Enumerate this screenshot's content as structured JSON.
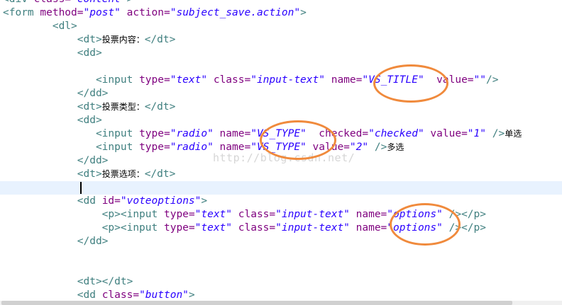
{
  "colors": {
    "tag": "#3f7f7f",
    "attribute": "#7f007f",
    "value": "#2a00ff",
    "highlight": "#f08a3c",
    "current_line": "#e8f2fe"
  },
  "lines": [
    [
      {
        "t": "<div ",
        "c": "tag"
      },
      {
        "t": "class=",
        "c": "attr"
      },
      {
        "t": "\"content\"",
        "c": "val"
      },
      {
        "t": ">",
        "c": "tag"
      }
    ],
    [
      {
        "t": "<form ",
        "c": "tag"
      },
      {
        "t": "method=",
        "c": "attr"
      },
      {
        "t": "\"post\"",
        "c": "val"
      },
      {
        "t": " action=",
        "c": "attr"
      },
      {
        "t": "\"subject_save.action\"",
        "c": "val"
      },
      {
        "t": ">",
        "c": "tag"
      }
    ],
    [
      {
        "t": "        <dl>",
        "c": "tag"
      }
    ],
    [
      {
        "t": "            <dt>",
        "c": "tag"
      },
      {
        "t": "投票内容：",
        "c": "txt"
      },
      {
        "t": "</dt>",
        "c": "tag"
      }
    ],
    [
      {
        "t": "            <dd>",
        "c": "tag"
      }
    ],
    [
      {
        "t": "",
        "c": "tag"
      }
    ],
    [
      {
        "t": "               <input ",
        "c": "tag"
      },
      {
        "t": "type=",
        "c": "attr"
      },
      {
        "t": "\"text\"",
        "c": "val"
      },
      {
        "t": " class=",
        "c": "attr"
      },
      {
        "t": "\"input-text\"",
        "c": "val"
      },
      {
        "t": " name=",
        "c": "attr"
      },
      {
        "t": "\"VS_TITLE\"",
        "c": "val"
      },
      {
        "t": "  value=",
        "c": "attr"
      },
      {
        "t": "\"\"",
        "c": "val"
      },
      {
        "t": "/>",
        "c": "tag"
      }
    ],
    [
      {
        "t": "            </dd>",
        "c": "tag"
      }
    ],
    [
      {
        "t": "            <dt>",
        "c": "tag"
      },
      {
        "t": "投票类型：",
        "c": "txt"
      },
      {
        "t": "</dt>",
        "c": "tag"
      }
    ],
    [
      {
        "t": "            <dd>",
        "c": "tag"
      }
    ],
    [
      {
        "t": "               <input ",
        "c": "tag"
      },
      {
        "t": "type=",
        "c": "attr"
      },
      {
        "t": "\"radio\"",
        "c": "val"
      },
      {
        "t": " name=",
        "c": "attr"
      },
      {
        "t": "\"VS_TYPE\"",
        "c": "val"
      },
      {
        "t": "  checked=",
        "c": "attr"
      },
      {
        "t": "\"checked\"",
        "c": "val"
      },
      {
        "t": " value=",
        "c": "attr"
      },
      {
        "t": "\"1\"",
        "c": "val"
      },
      {
        "t": " />",
        "c": "tag"
      },
      {
        "t": "单选",
        "c": "txt"
      }
    ],
    [
      {
        "t": "               <input ",
        "c": "tag"
      },
      {
        "t": "type=",
        "c": "attr"
      },
      {
        "t": "\"radio\"",
        "c": "val"
      },
      {
        "t": " name=",
        "c": "attr"
      },
      {
        "t": "\"VS_TYPE\"",
        "c": "val"
      },
      {
        "t": " value=",
        "c": "attr"
      },
      {
        "t": "\"2\"",
        "c": "val"
      },
      {
        "t": " />",
        "c": "tag"
      },
      {
        "t": "多选",
        "c": "txt"
      }
    ],
    [
      {
        "t": "            </dd>",
        "c": "tag"
      }
    ],
    [
      {
        "t": "            <dt>",
        "c": "tag"
      },
      {
        "t": "投票选项：",
        "c": "txt"
      },
      {
        "t": "</dt>",
        "c": "tag"
      }
    ],
    [
      {
        "t": "",
        "c": "tag"
      }
    ],
    [
      {
        "t": "            <dd ",
        "c": "tag"
      },
      {
        "t": "id=",
        "c": "attr"
      },
      {
        "t": "\"voteoptions\"",
        "c": "val"
      },
      {
        "t": ">",
        "c": "tag"
      }
    ],
    [
      {
        "t": "                <p><input ",
        "c": "tag"
      },
      {
        "t": "type=",
        "c": "attr"
      },
      {
        "t": "\"text\"",
        "c": "val"
      },
      {
        "t": " class=",
        "c": "attr"
      },
      {
        "t": "\"input-text\"",
        "c": "val"
      },
      {
        "t": " name=",
        "c": "attr"
      },
      {
        "t": "\"options\"",
        "c": "val"
      },
      {
        "t": " /></p>",
        "c": "tag"
      }
    ],
    [
      {
        "t": "                <p><input ",
        "c": "tag"
      },
      {
        "t": "type=",
        "c": "attr"
      },
      {
        "t": "\"text\"",
        "c": "val"
      },
      {
        "t": " class=",
        "c": "attr"
      },
      {
        "t": "\"input-text\"",
        "c": "val"
      },
      {
        "t": " name=",
        "c": "attr"
      },
      {
        "t": "\"options\"",
        "c": "val"
      },
      {
        "t": " /></p>",
        "c": "tag"
      }
    ],
    [
      {
        "t": "            </dd>",
        "c": "tag"
      }
    ],
    [
      {
        "t": "",
        "c": "tag"
      }
    ],
    [
      {
        "t": "",
        "c": "tag"
      }
    ],
    [
      {
        "t": "            <dt></dt>",
        "c": "tag"
      }
    ],
    [
      {
        "t": "            <dd ",
        "c": "tag"
      },
      {
        "t": "class=",
        "c": "attr"
      },
      {
        "t": "\"button\"",
        "c": "val"
      },
      {
        "t": ">",
        "c": "tag"
      }
    ]
  ],
  "watermark": "http://blog.csdn.net/"
}
